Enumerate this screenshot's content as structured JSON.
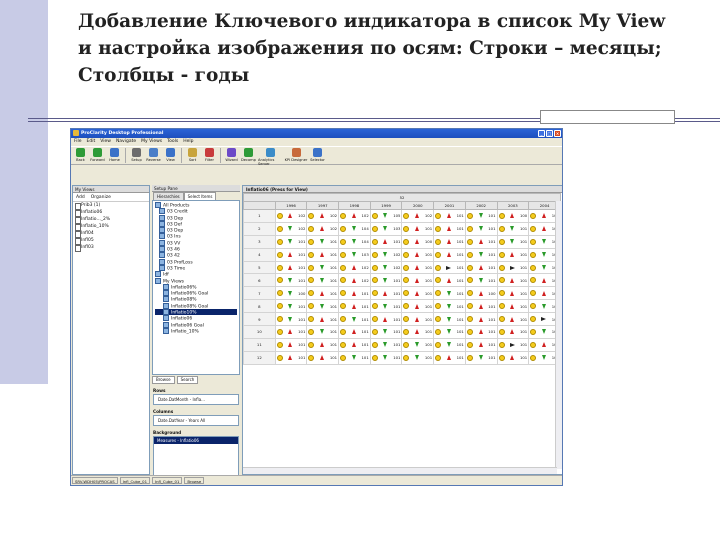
{
  "slide": {
    "title_line1": "Добавление Ключевого индикатора в список My View",
    "title_line2": "и настройка изображения по осям: Строки – месяцы;",
    "title_line3": "Столбцы - годы"
  },
  "app": {
    "window_title": "ProClarity Desktop Professional",
    "menu": [
      "File",
      "Edit",
      "View",
      "Navigate",
      "My Views",
      "Tools",
      "Help"
    ],
    "toolbar": [
      "Back",
      "Forward",
      "Home",
      "Setup",
      "Reverse",
      "View",
      "Sort",
      "Filter",
      "Wizard",
      "Decomp",
      "Analytics Server",
      "KPI Designer",
      "Selector"
    ],
    "left_pane": {
      "header": "My Views",
      "add_label": "Add",
      "organize_label": "Organize",
      "items": [
        "Prib3 (1)",
        "Inflatio06",
        "Inflatio..._2%",
        "Inflatio_10%",
        "Infl04",
        "Infl05",
        "Infl03"
      ]
    },
    "setup_pane": {
      "header": "Setup Pane",
      "tabs": [
        "Hierarchies",
        "Select Items"
      ],
      "tree": [
        "All Products",
        "03 Credit",
        "03 Dep",
        "03 Def",
        "03 Dep",
        "03 Ins",
        "03 VV",
        "03 46",
        "03 42",
        "03 ProfLoss",
        "03 Time",
        "Idf",
        "My Views",
        "Inflatio06%",
        "Inflatio06% Goal",
        "Inflatio08%",
        "Inflatio08% Goal",
        "Inflatio10%",
        "Inflatio06",
        "Inflatio06 Goal",
        "Inflatio_10%"
      ],
      "selected_index": 17,
      "browse_tab": "Browse",
      "search_tab": "Search",
      "rows_label": "Rows",
      "rows_value": "Date.DatMonth - Infla...",
      "columns_label": "Columns",
      "columns_value": "Date.DatYear - Years All",
      "background_label": "Background",
      "background_value": "Measures - Inflatio06"
    },
    "grid": {
      "title": "Inflatio06 (Press for View)",
      "subheader": "52",
      "columns": [
        "1996",
        "1997",
        "1998",
        "1999",
        "2000",
        "2001",
        "2002",
        "2003",
        "2004"
      ],
      "rows": [
        {
          "n": "1",
          "cells": [
            [
              "s",
              "u",
              "102"
            ],
            [
              "s",
              "u",
              "102"
            ],
            [
              "s",
              "u",
              "102"
            ],
            [
              "s",
              "d",
              "105"
            ],
            [
              "s",
              "u",
              "102"
            ],
            [
              "s",
              "u",
              "101"
            ],
            [
              "s",
              "d",
              "101"
            ],
            [
              "s",
              "u",
              "100"
            ],
            [
              "s",
              "u",
              "101"
            ]
          ]
        },
        {
          "n": "2",
          "cells": [
            [
              "s",
              "d",
              "102"
            ],
            [
              "s",
              "u",
              "102"
            ],
            [
              "s",
              "d",
              "104"
            ],
            [
              "s",
              "d",
              "103"
            ],
            [
              "s",
              "u",
              "101"
            ],
            [
              "s",
              "u",
              "101"
            ],
            [
              "s",
              "d",
              "101"
            ],
            [
              "s",
              "d",
              "101"
            ],
            [
              "s",
              "u",
              "101"
            ]
          ]
        },
        {
          "n": "3",
          "cells": [
            [
              "s",
              "d",
              "101"
            ],
            [
              "s",
              "d",
              "101"
            ],
            [
              "s",
              "d",
              "104"
            ],
            [
              "s",
              "u",
              "101"
            ],
            [
              "s",
              "u",
              "100"
            ],
            [
              "s",
              "u",
              "101"
            ],
            [
              "s",
              "u",
              "101"
            ],
            [
              "s",
              "d",
              "101"
            ],
            [
              "s",
              "d",
              "101"
            ]
          ]
        },
        {
          "n": "4",
          "cells": [
            [
              "s",
              "u",
              "101"
            ],
            [
              "s",
              "u",
              "101"
            ],
            [
              "s",
              "d",
              "103"
            ],
            [
              "s",
              "d",
              "102"
            ],
            [
              "s",
              "u",
              "101"
            ],
            [
              "s",
              "u",
              "101"
            ],
            [
              "s",
              "d",
              "101"
            ],
            [
              "s",
              "u",
              "101"
            ],
            [
              "s",
              "d",
              "101"
            ]
          ]
        },
        {
          "n": "5",
          "cells": [
            [
              "s",
              "u",
              "101"
            ],
            [
              "s",
              "d",
              "101"
            ],
            [
              "s",
              "u",
              "102"
            ],
            [
              "s",
              "d",
              "102"
            ],
            [
              "s",
              "u",
              "101"
            ],
            [
              "s",
              "r",
              "101"
            ],
            [
              "s",
              "u",
              "101"
            ],
            [
              "s",
              "r",
              "101"
            ],
            [
              "s",
              "d",
              "101"
            ]
          ]
        },
        {
          "n": "6",
          "cells": [
            [
              "s",
              "d",
              "101"
            ],
            [
              "s",
              "d",
              "101"
            ],
            [
              "s",
              "u",
              "102"
            ],
            [
              "s",
              "d",
              "101"
            ],
            [
              "s",
              "u",
              "101"
            ],
            [
              "s",
              "u",
              "101"
            ],
            [
              "s",
              "d",
              "101"
            ],
            [
              "s",
              "u",
              "101"
            ],
            [
              "s",
              "u",
              "101"
            ]
          ]
        },
        {
          "n": "7",
          "cells": [
            [
              "s",
              "d",
              "100"
            ],
            [
              "s",
              "u",
              "101"
            ],
            [
              "s",
              "u",
              "101"
            ],
            [
              "s",
              "u",
              "101"
            ],
            [
              "s",
              "u",
              "101"
            ],
            [
              "s",
              "d",
              "101"
            ],
            [
              "s",
              "u",
              "100"
            ],
            [
              "s",
              "u",
              "101"
            ],
            [
              "s",
              "u",
              "101"
            ]
          ]
        },
        {
          "n": "8",
          "cells": [
            [
              "s",
              "d",
              "101"
            ],
            [
              "s",
              "d",
              "101"
            ],
            [
              "s",
              "u",
              "101"
            ],
            [
              "s",
              "d",
              "101"
            ],
            [
              "s",
              "u",
              "101"
            ],
            [
              "s",
              "d",
              "101"
            ],
            [
              "s",
              "u",
              "101"
            ],
            [
              "s",
              "u",
              "101"
            ],
            [
              "s",
              "d",
              "101"
            ]
          ]
        },
        {
          "n": "9",
          "cells": [
            [
              "s",
              "d",
              "101"
            ],
            [
              "s",
              "u",
              "101"
            ],
            [
              "s",
              "d",
              "101"
            ],
            [
              "s",
              "u",
              "101"
            ],
            [
              "s",
              "u",
              "101"
            ],
            [
              "s",
              "d",
              "101"
            ],
            [
              "s",
              "u",
              "101"
            ],
            [
              "s",
              "u",
              "101"
            ],
            [
              "s",
              "r",
              "101"
            ]
          ]
        },
        {
          "n": "10",
          "cells": [
            [
              "s",
              "u",
              "101"
            ],
            [
              "s",
              "d",
              "101"
            ],
            [
              "s",
              "u",
              "101"
            ],
            [
              "s",
              "d",
              "101"
            ],
            [
              "s",
              "u",
              "101"
            ],
            [
              "s",
              "d",
              "101"
            ],
            [
              "s",
              "u",
              "101"
            ],
            [
              "s",
              "u",
              "101"
            ],
            [
              "s",
              "d",
              "101"
            ]
          ]
        },
        {
          "n": "11",
          "cells": [
            [
              "s",
              "u",
              "101"
            ],
            [
              "s",
              "u",
              "101"
            ],
            [
              "s",
              "u",
              "101"
            ],
            [
              "s",
              "d",
              "101"
            ],
            [
              "s",
              "d",
              "101"
            ],
            [
              "s",
              "d",
              "101"
            ],
            [
              "s",
              "u",
              "101"
            ],
            [
              "s",
              "r",
              "101"
            ],
            [
              "s",
              "u",
              "101"
            ]
          ]
        },
        {
          "n": "12",
          "cells": [
            [
              "s",
              "u",
              "101"
            ],
            [
              "s",
              "u",
              "101"
            ],
            [
              "s",
              "d",
              "101"
            ],
            [
              "s",
              "d",
              "101"
            ],
            [
              "s",
              "d",
              "101"
            ],
            [
              "s",
              "u",
              "101"
            ],
            [
              "s",
              "d",
              "101"
            ],
            [
              "s",
              "u",
              "101"
            ],
            [
              "s",
              "d",
              "101"
            ]
          ]
        }
      ]
    },
    "statusbar": [
      "SRV-WDH05\\PROCAS",
      "Infl_Cube_01",
      "Infl_Cube_01",
      "Browse"
    ]
  }
}
